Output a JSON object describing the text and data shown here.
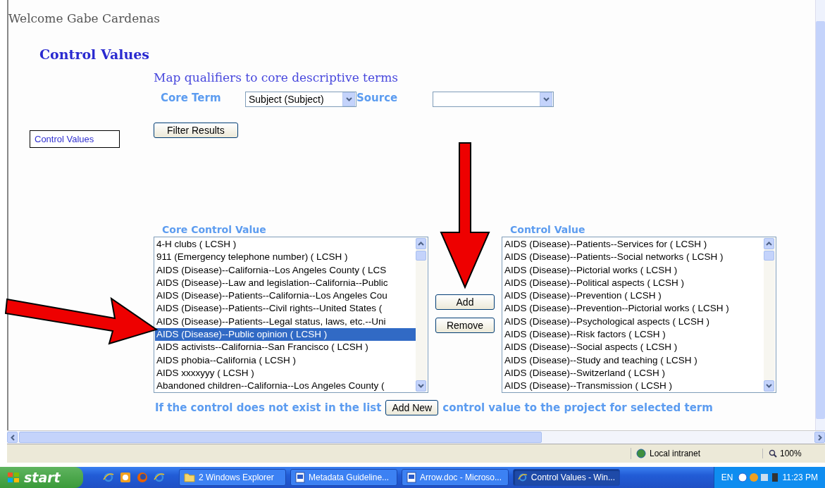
{
  "welcome": "Welcome Gabe Cardenas",
  "heading": "Control Values",
  "side_box": "Control Values",
  "subtitle": "Map qualifiers to core descriptive terms",
  "filters": [
    {
      "label": "Core Term",
      "value": "Subject (Subject)"
    },
    {
      "label": "Source"
    }
  ],
  "filter_button": "Filter Results",
  "core_list": {
    "label": "Core Control Value",
    "items": [
      {
        "text": "4-H clubs ( LCSH )",
        "selected": false
      },
      {
        "text": "911 (Emergency telephone number) ( LCSH )",
        "selected": false
      },
      {
        "text": "AIDS (Disease)--California--Los Angeles County ( LCS",
        "selected": false
      },
      {
        "text": "AIDS (Disease)--Law and legislation--California--Public",
        "selected": false
      },
      {
        "text": "AIDS (Disease)--Patients--California--Los Angeles Cou",
        "selected": false
      },
      {
        "text": "AIDS (Disease)--Patients--Civil rights--United States (",
        "selected": false
      },
      {
        "text": "AIDS (Disease)--Patients--Legal status, laws, etc.--Uni",
        "selected": false
      },
      {
        "text": "AIDS (Disease)--Public opinion ( LCSH )",
        "selected": true
      },
      {
        "text": "AIDS activists--California--San Francisco ( LCSH )",
        "selected": false
      },
      {
        "text": "AIDS phobia--California ( LCSH )",
        "selected": false
      },
      {
        "text": "AIDS xxxxyyy ( LCSH )",
        "selected": false
      },
      {
        "text": "Abandoned children--California--Los Angeles County (",
        "selected": false
      }
    ]
  },
  "middle_buttons": [
    "Add",
    "Remove"
  ],
  "control_list": {
    "label": "Control Value",
    "items": [
      {
        "text": "AIDS (Disease)--Patients--Services for ( LCSH )",
        "selected": false
      },
      {
        "text": "AIDS (Disease)--Patients--Social networks ( LCSH )",
        "selected": false
      },
      {
        "text": "AIDS (Disease)--Pictorial works ( LCSH )",
        "selected": false
      },
      {
        "text": "AIDS (Disease)--Political aspects ( LCSH )",
        "selected": false
      },
      {
        "text": "AIDS (Disease)--Prevention ( LCSH )",
        "selected": false
      },
      {
        "text": "AIDS (Disease)--Prevention--Pictorial works ( LCSH )",
        "selected": false
      },
      {
        "text": "AIDS (Disease)--Psychological aspects ( LCSH )",
        "selected": false
      },
      {
        "text": "AIDS (Disease)--Risk factors ( LCSH )",
        "selected": false
      },
      {
        "text": "AIDS (Disease)--Social aspects ( LCSH )",
        "selected": false
      },
      {
        "text": "AIDS (Disease)--Study and teaching ( LCSH )",
        "selected": false
      },
      {
        "text": "AIDS (Disease)--Switzerland ( LCSH )",
        "selected": false
      },
      {
        "text": "AIDS (Disease)--Transmission ( LCSH )",
        "selected": false
      }
    ]
  },
  "footer": {
    "before": "If the control does not exist in the list",
    "button": "Add New",
    "after": "control value to the project for selected term"
  },
  "status_bar": {
    "zone": "Local intranet",
    "zoom": "100%"
  },
  "taskbar": {
    "start": "start",
    "tasks": [
      {
        "label": "2 Windows Explorer",
        "kind": "group",
        "selected": false
      },
      {
        "label": "Metadata Guideline...",
        "kind": "document",
        "selected": false
      },
      {
        "label": "Arrow.doc - Microso...",
        "kind": "document",
        "selected": false
      },
      {
        "label": "Control Values - Win...",
        "kind": "browser",
        "selected": true
      }
    ],
    "language": "EN",
    "clock": "11:23 PM"
  }
}
